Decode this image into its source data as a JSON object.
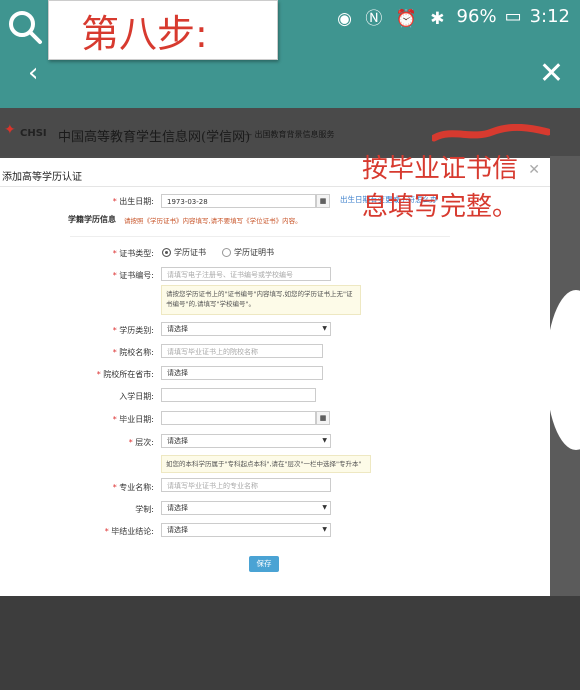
{
  "overlay": {
    "step_label": "第八步:",
    "annotation": "按毕业证书信息填写完整。"
  },
  "status_bar": {
    "battery": "96%",
    "time": "3:12"
  },
  "site": {
    "logo_text": "CHSI",
    "title": "中国高等教育学生信息网(学信网)",
    "subtitle": "— 出国教育背景信息服务"
  },
  "modal": {
    "title": "添加高等学历认证",
    "birth": {
      "label": "出生日期:",
      "value": "1973-03-28",
      "link": "出生日期有变更或不符怎么办"
    },
    "section_title": "学籍学历信息",
    "section_note": "请按照《学历证书》内容填写,请不要填写《学位证书》内容。",
    "cert_type": {
      "label": "证书类型:",
      "option1": "学历证书",
      "option2": "学历证明书"
    },
    "cert_no": {
      "label": "证书编号:",
      "placeholder": "请填写电子注册号、证书编号或学校编号",
      "hint": "请按您学历证书上的\"证书编号\"内容填写,如您的学历证书上无\"证书编号\"的,请填写\"学校编号\"。"
    },
    "degree_type": {
      "label": "学历类别:",
      "value": "请选择"
    },
    "school": {
      "label": "院校名称:",
      "placeholder": "请填写毕业证书上的院校名称"
    },
    "province": {
      "label": "院校所在省市:",
      "value": "请选择"
    },
    "enroll": {
      "label": "入学日期:"
    },
    "graduate": {
      "label": "毕业日期:"
    },
    "level": {
      "label": "层次:",
      "value": "请选择",
      "hint": "如您的本科学历属于\"专科起点本科\",请在\"层次\"一栏中选择\"专升本\""
    },
    "major": {
      "label": "专业名称:",
      "placeholder": "请填写毕业证书上的专业名称"
    },
    "duration": {
      "label": "学制:",
      "value": "请选择"
    },
    "conclusion": {
      "label": "毕结业结论:",
      "value": "请选择"
    },
    "save_label": "保存"
  }
}
